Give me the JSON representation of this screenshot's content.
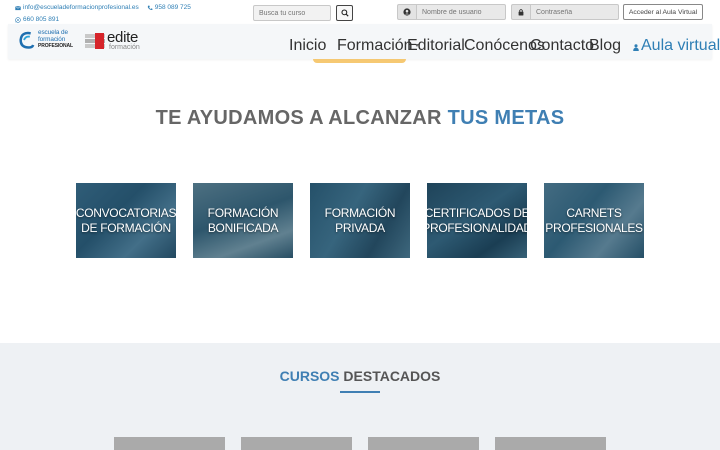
{
  "contact": {
    "email": "info@escueladeformacionprofesional.es",
    "phone": "958 089 725",
    "whatsapp": "660 805 891"
  },
  "search": {
    "placeholder": "Busca tu curso"
  },
  "login": {
    "username_placeholder": "Nombre de usuario",
    "password_placeholder": "Contraseña",
    "aula_button": "Acceder al Aula Virtual"
  },
  "logos": {
    "school": {
      "line1": "escuela de",
      "line2": "formación",
      "line3": "PROFESIONAL"
    },
    "edite": {
      "name": "edite",
      "sub": "formación"
    }
  },
  "nav": {
    "items": [
      "Inicio",
      "Formación",
      "Editorial",
      "Conócenos",
      "Contacto",
      "Blog"
    ],
    "aula_virtual": "Aula virtual"
  },
  "hero": {
    "title_prefix": "TE AYUDAMOS A ALCANZAR",
    "title_accent": "TUS METAS"
  },
  "tiles": [
    {
      "label": "CONVOCATORIAS DE FORMACIÓN"
    },
    {
      "label": "FORMACIÓN BONIFICADA"
    },
    {
      "label": "FORMACIÓN PRIVADA"
    },
    {
      "label": "CERTIFICADOS DE PROFESIONALIDAD"
    },
    {
      "label": "CARNETS PROFESIONALES"
    }
  ],
  "courses": {
    "title_accent": "CURSOS",
    "title_rest": "DESTACADOS"
  },
  "colors": {
    "accent": "#3f7fb3",
    "link": "#2f7fb5",
    "tile_overlay": "#143c55"
  },
  "icons": {
    "email": "envelope-icon",
    "phone": "phone-icon",
    "whatsapp": "whatsapp-icon",
    "search": "search-icon",
    "user": "user-circle-icon",
    "lock": "lock-icon",
    "aula": "user-icon"
  }
}
